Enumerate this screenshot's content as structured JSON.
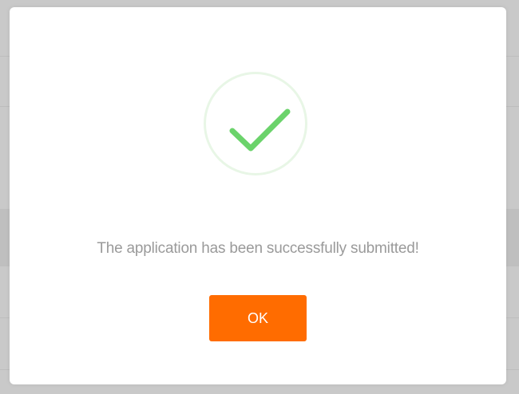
{
  "dialog": {
    "message": "The application has been successfully submitted!",
    "ok_label": "OK",
    "icon": "success-checkmark-icon"
  },
  "colors": {
    "accent": "#ff6c00",
    "success": "#6bd36b",
    "success_ring": "#e8f6e6",
    "message_text": "#9a9a9a",
    "overlay": "#c8c8c8"
  }
}
